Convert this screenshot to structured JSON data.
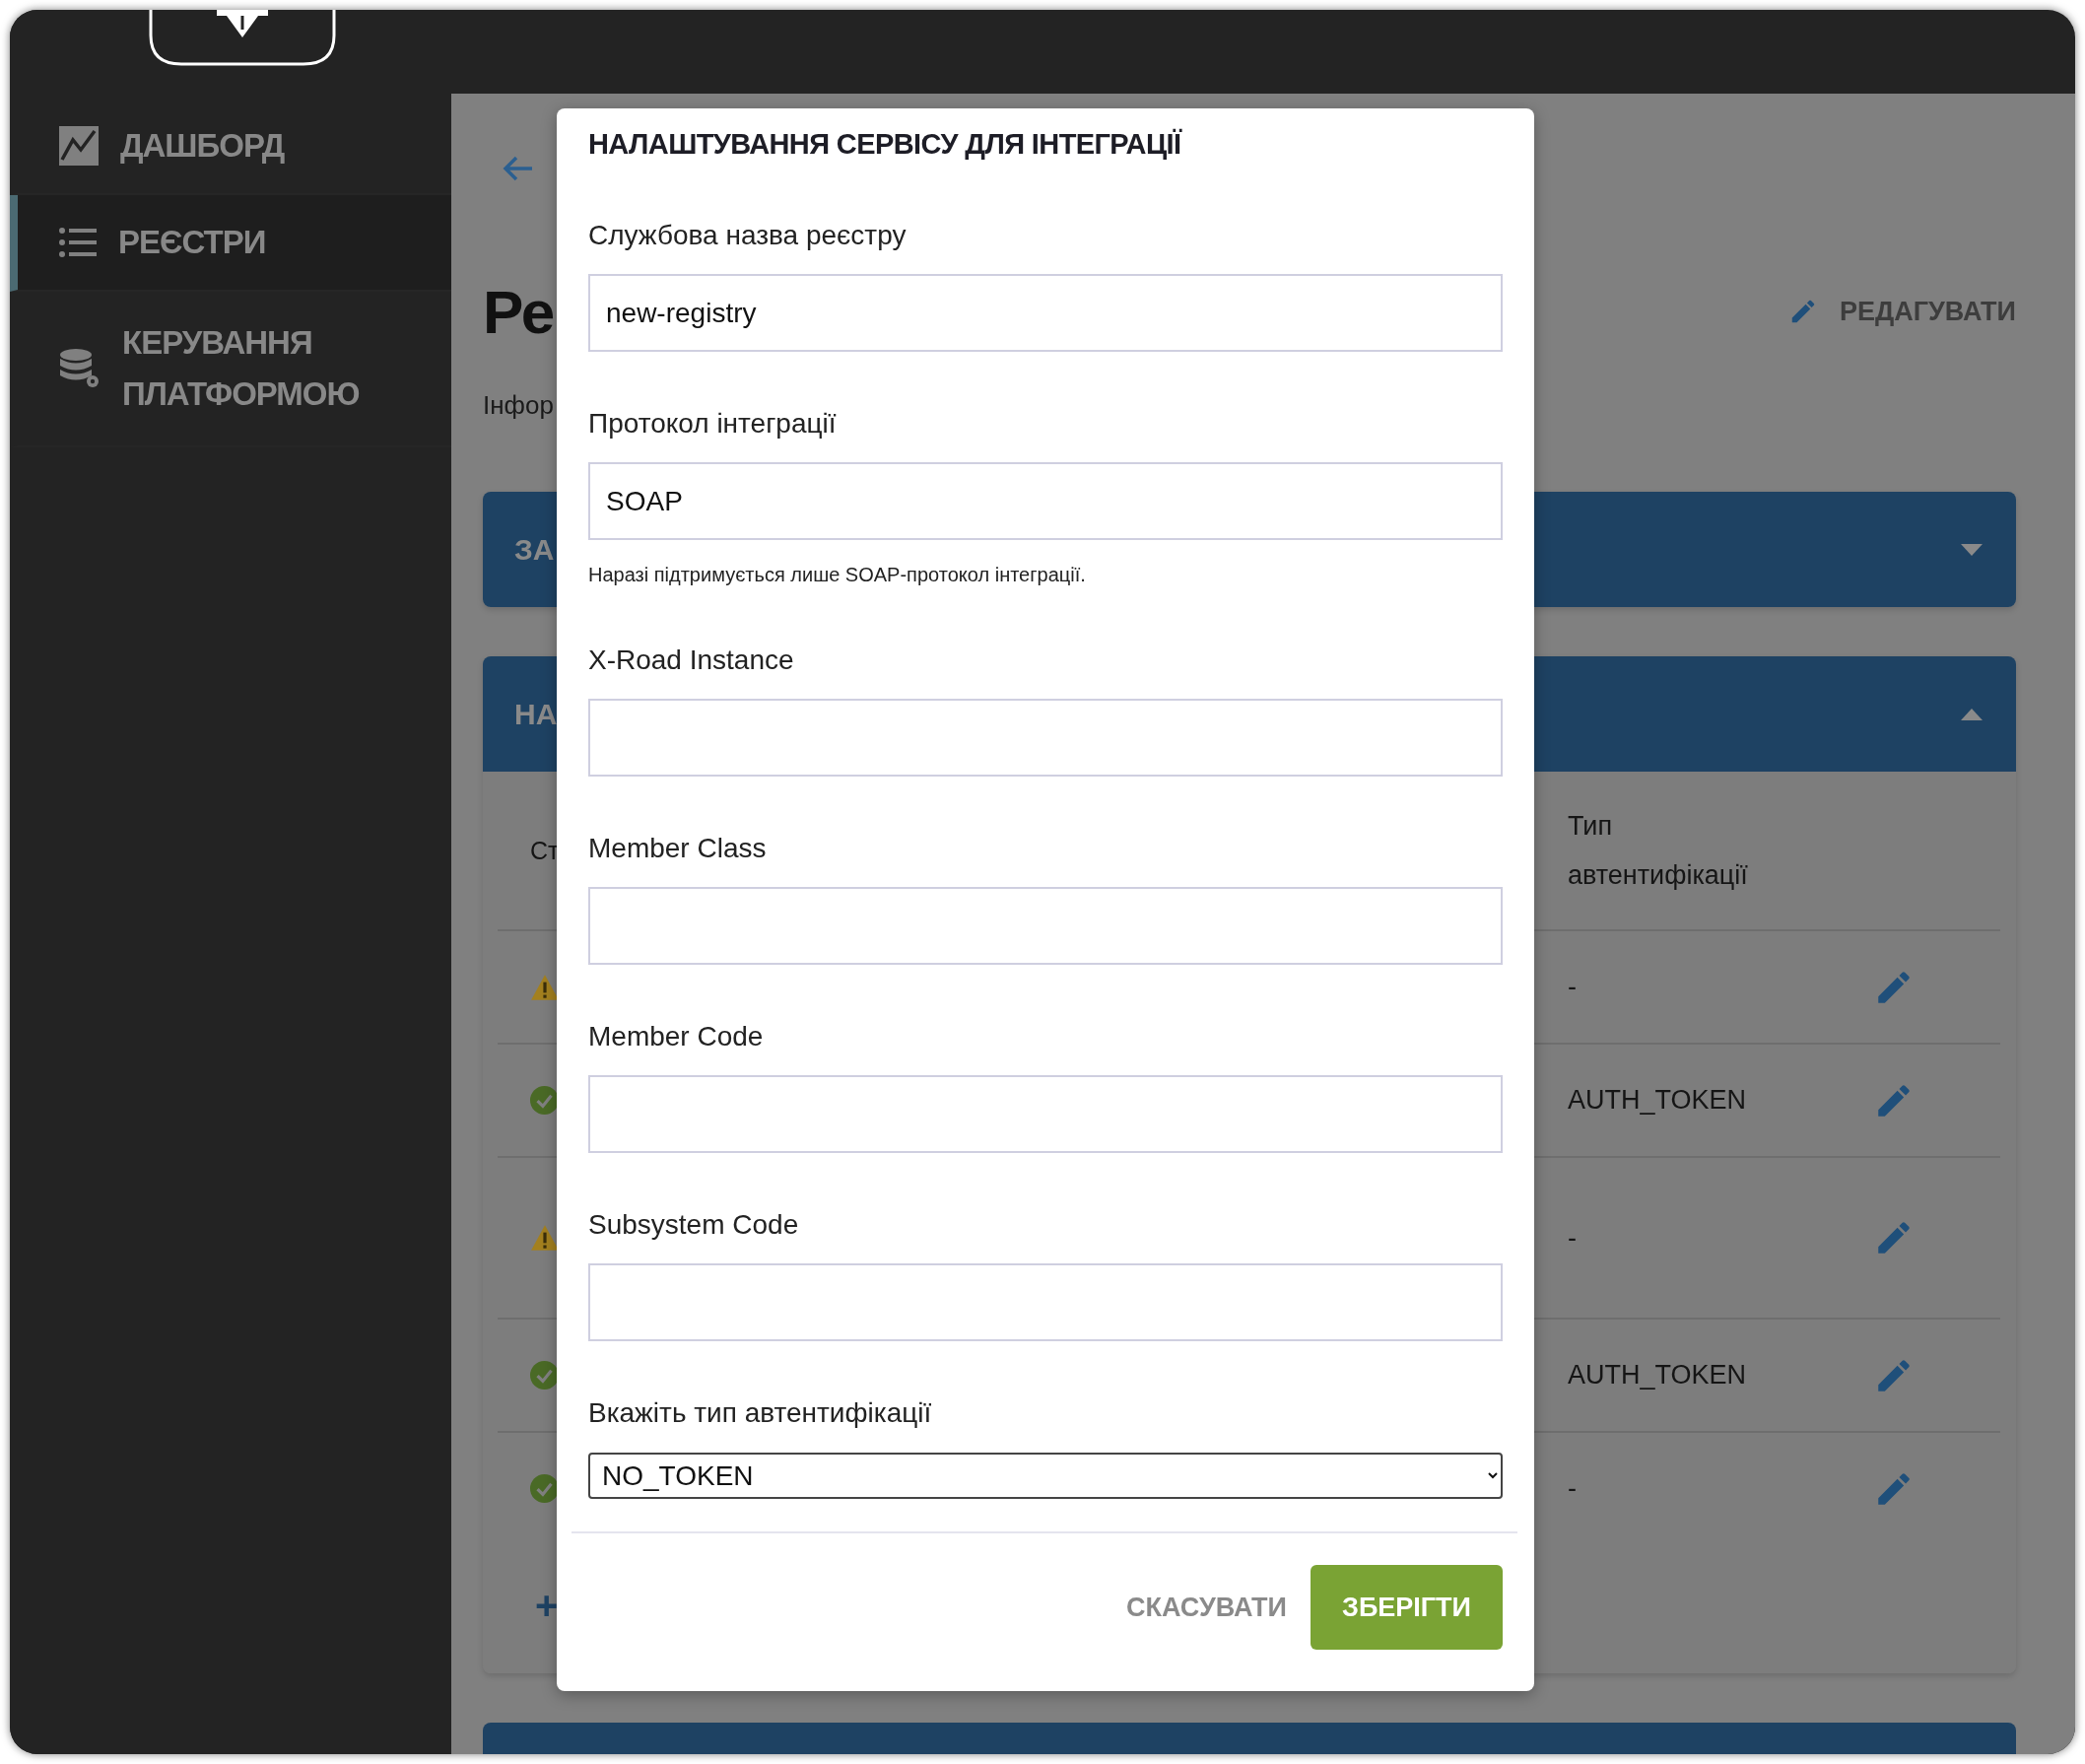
{
  "sidebar": {
    "items": [
      {
        "label": "ДАШБОРД",
        "selected": false
      },
      {
        "label": "РЕЄСТРИ",
        "selected": true
      },
      {
        "label": "КЕРУВАННЯ ПЛАТФОРМОЮ",
        "selected": false
      }
    ]
  },
  "page": {
    "title": "Ре",
    "subtitle": "Інфор",
    "edit_button": "РЕДАГУВАТИ"
  },
  "panels": [
    {
      "title": "ЗА",
      "expanded": false
    },
    {
      "title": "НА",
      "expanded": true,
      "table": {
        "columns": [
          "Ст",
          "Тип автентифікації"
        ],
        "rows": [
          {
            "kind": "warning",
            "auth": "-"
          },
          {
            "kind": "ok",
            "auth": "AUTH_TOKEN"
          },
          {
            "kind": "warning",
            "auth": "-"
          },
          {
            "kind": "ok",
            "auth": "AUTH_TOKEN"
          },
          {
            "kind": "ok",
            "auth": "-"
          }
        ]
      },
      "add_button": "+"
    }
  ],
  "modal": {
    "title": "НАЛАШТУВАННЯ СЕРВІСУ ДЛЯ ІНТЕГРАЦІЇ",
    "fields": [
      {
        "kind": "input",
        "label": "Службова назва реєстру",
        "value": "new-registry"
      },
      {
        "kind": "input",
        "label": "Протокол інтеграції",
        "value": "SOAP",
        "help": "Наразі підтримується лише SOAP-протокол інтеграції."
      },
      {
        "kind": "input",
        "label": "X-Road Instance"
      },
      {
        "kind": "input",
        "label": "Member Class"
      },
      {
        "kind": "input",
        "label": "Member Code"
      },
      {
        "kind": "input",
        "label": "Subsystem Code"
      },
      {
        "kind": "select",
        "label": "Вкажіть тип автентифікації",
        "value": "NO_TOKEN"
      }
    ],
    "cancel_button": "СКАСУВАТИ",
    "save_button": "ЗБЕРІГТИ"
  }
}
